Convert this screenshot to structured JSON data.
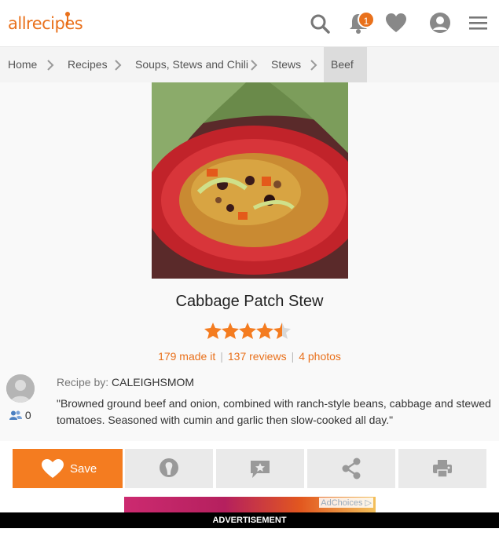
{
  "header": {
    "logo_text": "allrecipes",
    "notification_count": "1",
    "icons": [
      "search-icon",
      "bell-icon",
      "heart-icon",
      "user-icon",
      "menu-icon"
    ],
    "accent_color": "#e9711c"
  },
  "breadcrumb": {
    "items": [
      "Home",
      "Recipes",
      "Soups, Stews and Chili",
      "Stews",
      "Beef"
    ],
    "active_index": 4
  },
  "recipe": {
    "title": "Cabbage Patch Stew",
    "rating": 4.5,
    "rating_max": 5,
    "made_it": "179 made it",
    "reviews": "137 reviews",
    "photos": "4 photos",
    "byline_label": "Recipe by:",
    "author": "CALEIGHSMOM",
    "followers": "0",
    "description": "\"Browned ground beef and onion, combined with ranch-style beans, cabbage and stewed tomatoes. Seasoned with cumin and garlic then slow-cooked all day.\""
  },
  "actions": {
    "save_label": "Save",
    "buttons": [
      "save-button",
      "made-it-button",
      "review-button",
      "share-button",
      "print-button"
    ]
  },
  "ad": {
    "choices_label": "AdChoices",
    "label": "ADVERTISEMENT"
  }
}
